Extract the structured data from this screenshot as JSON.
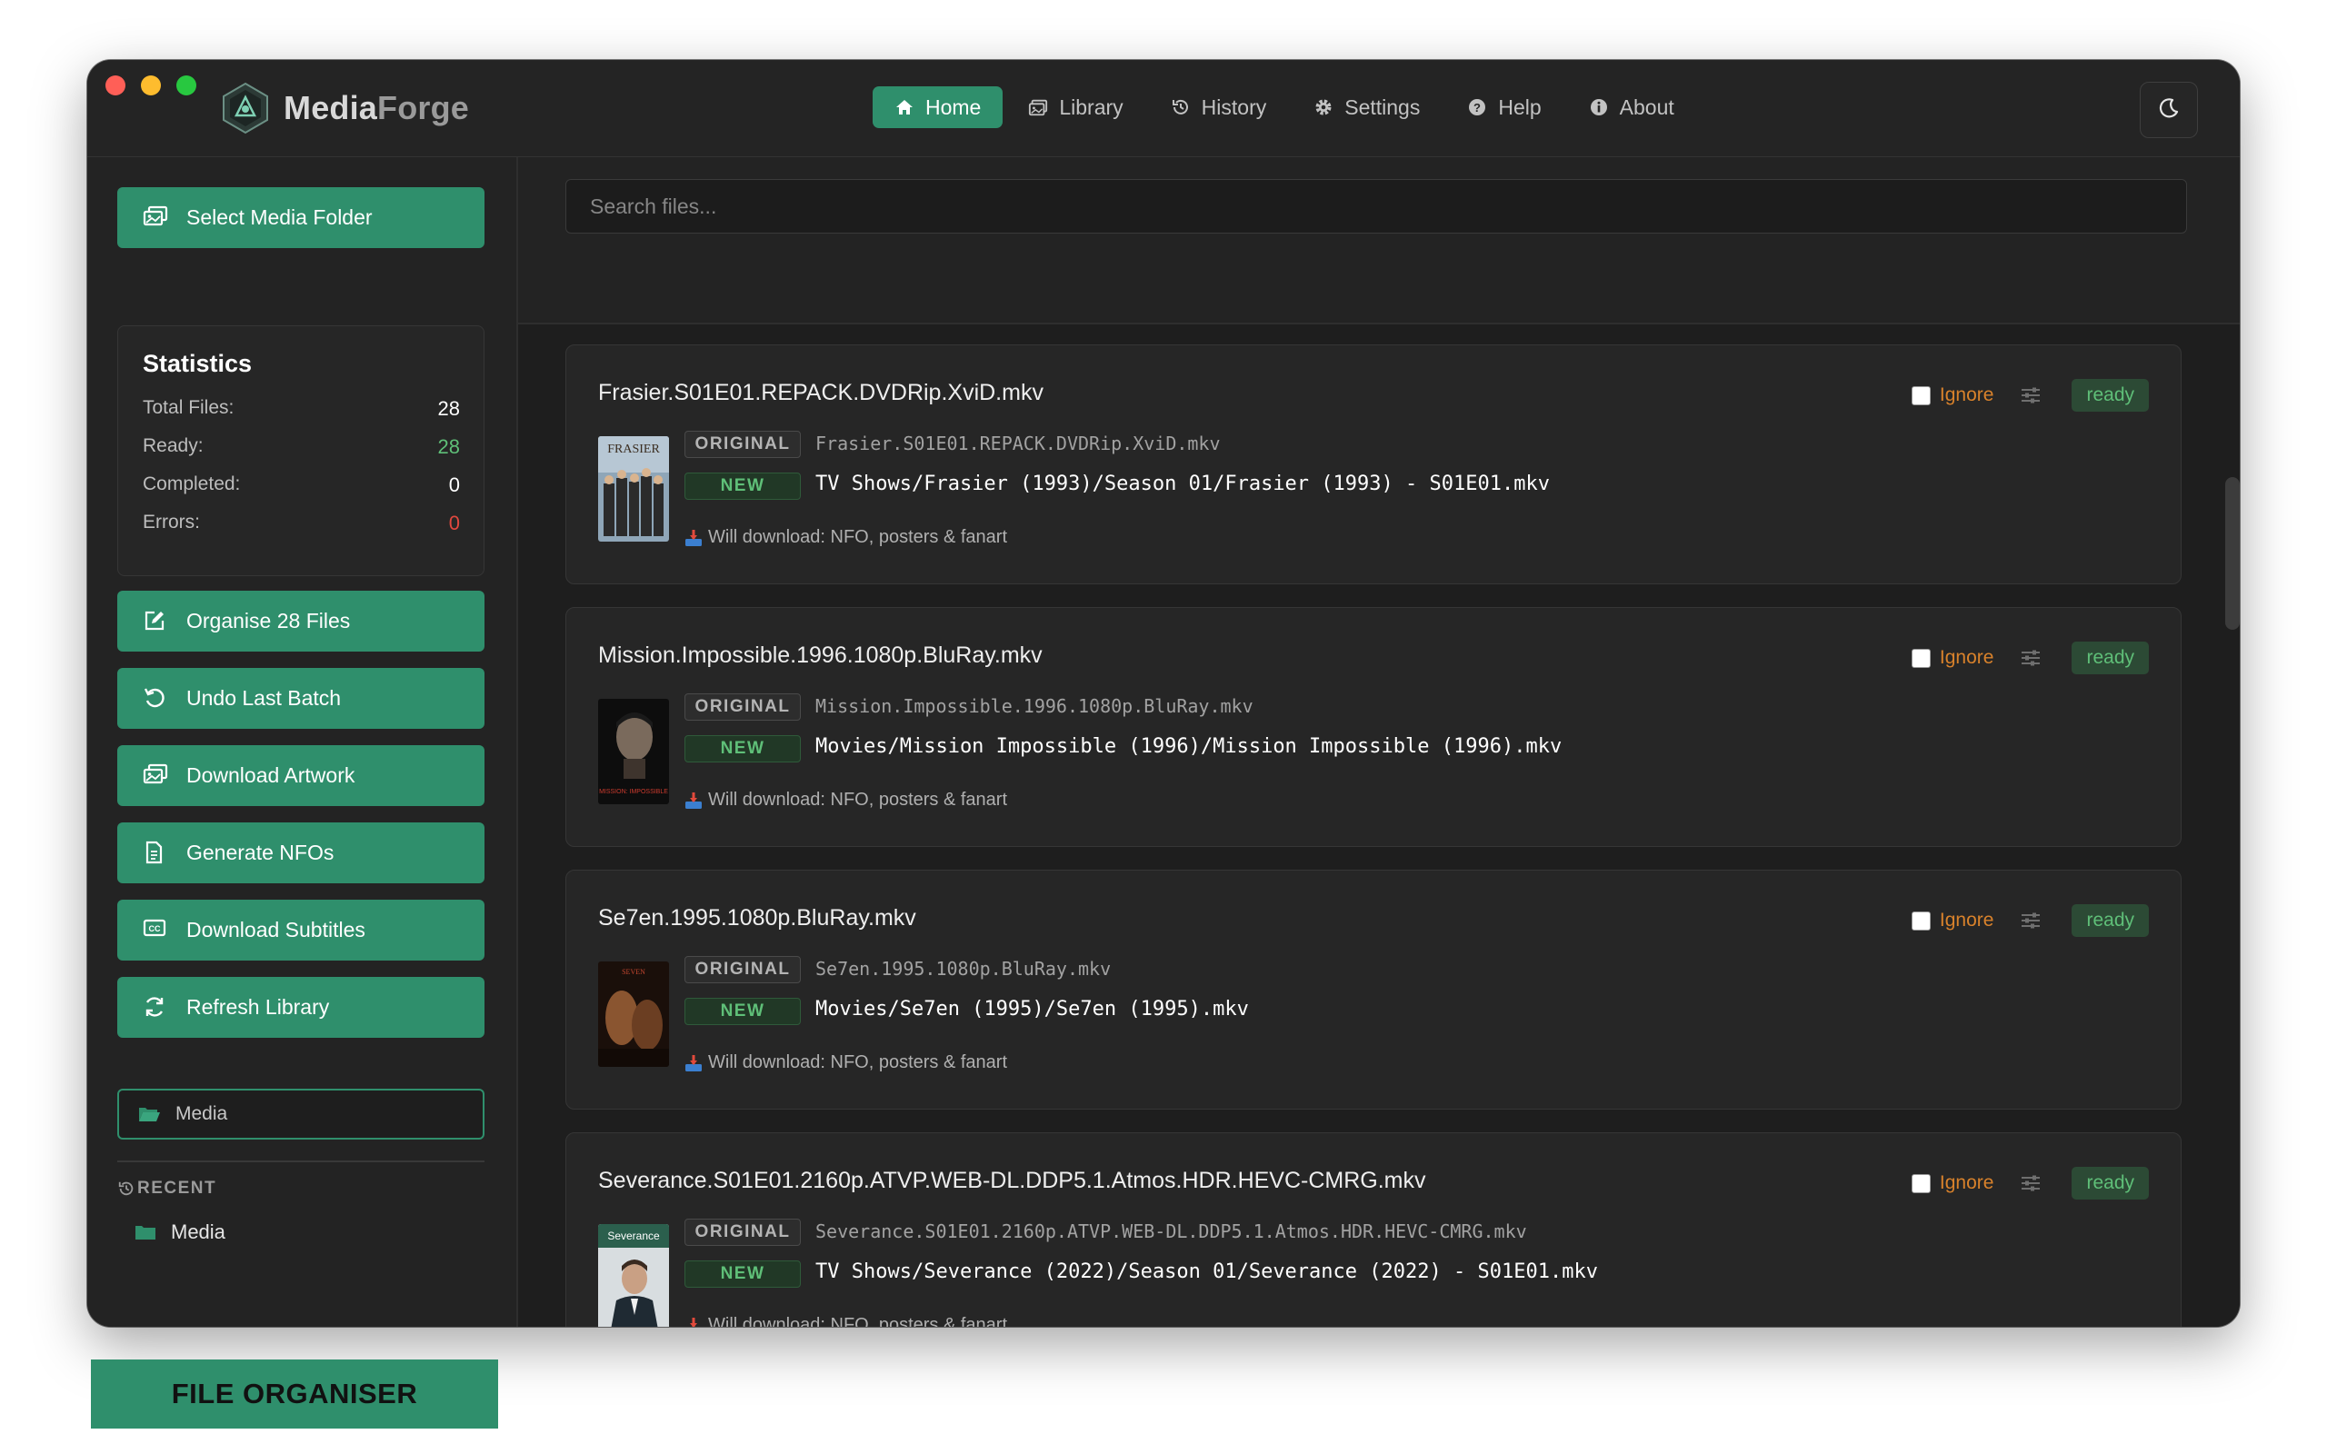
{
  "app": {
    "brand_main": "Media",
    "brand_accent": "Forge",
    "accent_color": "#2f8f6c"
  },
  "nav": {
    "items": [
      {
        "label": "Home",
        "icon": "home-icon",
        "active": true
      },
      {
        "label": "Library",
        "icon": "library-icon",
        "active": false
      },
      {
        "label": "History",
        "icon": "history-icon",
        "active": false
      },
      {
        "label": "Settings",
        "icon": "gear-icon",
        "active": false
      },
      {
        "label": "Help",
        "icon": "help-icon",
        "active": false
      },
      {
        "label": "About",
        "icon": "info-icon",
        "active": false
      }
    ],
    "theme_toggle_icon": "moon-icon"
  },
  "sidebar": {
    "select_folder_label": "Select Media Folder",
    "stats": {
      "title": "Statistics",
      "total_label": "Total Files:",
      "total_value": "28",
      "ready_label": "Ready:",
      "ready_value": "28",
      "completed_label": "Completed:",
      "completed_value": "0",
      "errors_label": "Errors:",
      "errors_value": "0"
    },
    "actions": [
      {
        "label": "Organise 28 Files",
        "icon": "edit-icon"
      },
      {
        "label": "Undo Last Batch",
        "icon": "undo-icon"
      },
      {
        "label": "Download Artwork",
        "icon": "images-icon"
      },
      {
        "label": "Generate NFOs",
        "icon": "document-icon"
      },
      {
        "label": "Download Subtitles",
        "icon": "closed-captions-icon"
      },
      {
        "label": "Refresh Library",
        "icon": "refresh-icon"
      }
    ],
    "folder_value": "Media",
    "recent_heading": "RECENT",
    "recent_items": [
      "Media"
    ]
  },
  "main": {
    "search_placeholder": "Search files...",
    "ignore_label": "Ignore",
    "original_tag": "ORIGINAL",
    "new_tag": "NEW",
    "files": [
      {
        "filename": "Frasier.S01E01.REPACK.DVDRip.XviD.mkv",
        "original": "Frasier.S01E01.REPACK.DVDRip.XviD.mkv",
        "new": "TV Shows/Frasier (1993)/Season 01/Frasier (1993) - S01E01.mkv",
        "download_note": "Will download: NFO, posters & fanart",
        "status": "ready",
        "poster_text": "FRASIER"
      },
      {
        "filename": "Mission.Impossible.1996.1080p.BluRay.mkv",
        "original": "Mission.Impossible.1996.1080p.BluRay.mkv",
        "new": "Movies/Mission Impossible (1996)/Mission Impossible (1996).mkv",
        "download_note": "Will download: NFO, posters & fanart",
        "status": "ready",
        "poster_text": "MISSION: IMPOSSIBLE"
      },
      {
        "filename": "Se7en.1995.1080p.BluRay.mkv",
        "original": "Se7en.1995.1080p.BluRay.mkv",
        "new": "Movies/Se7en (1995)/Se7en (1995).mkv",
        "download_note": "Will download: NFO, posters & fanart",
        "status": "ready",
        "poster_text": "SEVEN"
      },
      {
        "filename": "Severance.S01E01.2160p.ATVP.WEB-DL.DDP5.1.Atmos.HDR.HEVC-CMRG.mkv",
        "original": "Severance.S01E01.2160p.ATVP.WEB-DL.DDP5.1.Atmos.HDR.HEVC-CMRG.mkv",
        "new": "TV Shows/Severance (2022)/Season 01/Severance (2022) - S01E01.mkv",
        "download_note": "Will download: NFO, posters & fanart",
        "status": "ready",
        "poster_text": "Severance"
      }
    ]
  },
  "footer": {
    "label": "FILE ORGANISER"
  }
}
